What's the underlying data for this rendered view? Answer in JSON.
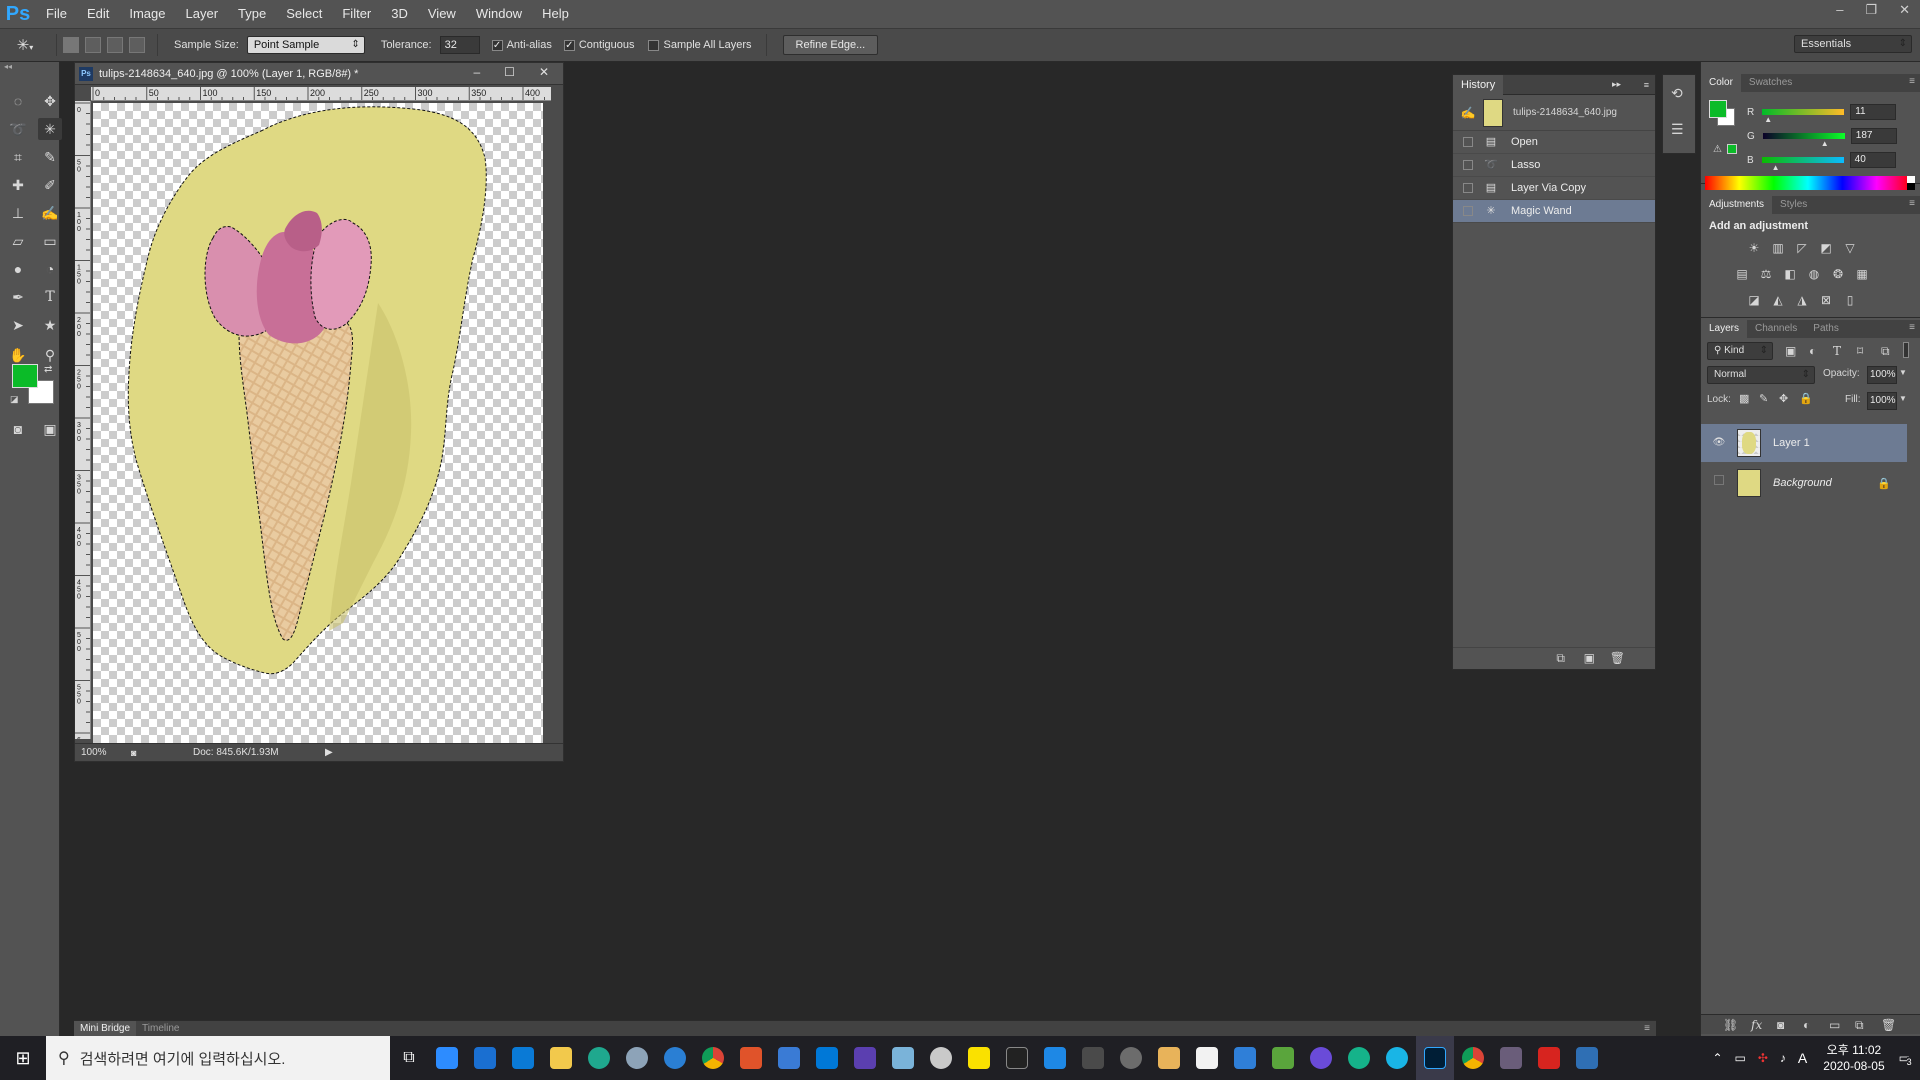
{
  "app": {
    "logo": "Ps",
    "menu": [
      "File",
      "Edit",
      "Image",
      "Layer",
      "Type",
      "Select",
      "Filter",
      "3D",
      "View",
      "Window",
      "Help"
    ],
    "win_minimize": "–",
    "win_restore": "❐",
    "win_close": "✕"
  },
  "options": {
    "sample_size_label": "Sample Size:",
    "sample_size_value": "Point Sample",
    "tolerance_label": "Tolerance:",
    "tolerance_value": "32",
    "anti_alias_label": "Anti-alias",
    "anti_alias_checked": true,
    "contiguous_label": "Contiguous",
    "contiguous_checked": true,
    "sample_all_layers_label": "Sample All Layers",
    "sample_all_layers_checked": false,
    "refine_edge_label": "Refine Edge...",
    "workspace_value": "Essentials"
  },
  "document": {
    "icon": "Ps",
    "title": "tulips-2148634_640.jpg @ 100% (Layer 1, RGB/8#) *",
    "zoom": "100%",
    "doc_size": "Doc: 845.6K/1.93M",
    "ruler_top": [
      "0",
      "50",
      "100",
      "150",
      "200",
      "250",
      "300",
      "350",
      "400"
    ],
    "ruler_left": [
      "0",
      "5\n0",
      "1\n0\n0",
      "1\n5\n0",
      "2\n0\n0",
      "2\n5\n0",
      "3\n0\n0",
      "3\n5\n0",
      "4\n0\n0",
      "4\n5\n0",
      "5\n0\n0",
      "5\n5\n0",
      "6\n0\n0"
    ]
  },
  "history": {
    "tab": "History",
    "snapshot_label": "tulips-2148634_640.jpg",
    "items": [
      {
        "label": "Open",
        "icon": "document-icon"
      },
      {
        "label": "Lasso",
        "icon": "lasso-icon"
      },
      {
        "label": "Layer Via Copy",
        "icon": "document-icon"
      },
      {
        "label": "Magic Wand",
        "icon": "magic-wand-icon"
      }
    ],
    "selected_index": 3
  },
  "color_panel": {
    "tabs": [
      "Color",
      "Swatches"
    ],
    "r_label": "R",
    "r_value": "11",
    "g_label": "G",
    "g_value": "187",
    "b_label": "B",
    "b_value": "40",
    "foreground": "#0bbb28",
    "background": "#ffffff"
  },
  "adjustments": {
    "tabs": [
      "Adjustments",
      "Styles"
    ],
    "heading": "Add an adjustment"
  },
  "layers": {
    "tabs": [
      "Layers",
      "Channels",
      "Paths"
    ],
    "kind_label": "Kind",
    "blend_mode": "Normal",
    "opacity_label": "Opacity:",
    "opacity_value": "100%",
    "lock_label": "Lock:",
    "fill_label": "Fill:",
    "fill_value": "100%",
    "items": [
      {
        "name": "Layer 1",
        "visible": true,
        "selected": true
      },
      {
        "name": "Background",
        "visible": false,
        "selected": false,
        "locked": true
      }
    ]
  },
  "bottom_tabs": [
    "Mini Bridge",
    "Timeline"
  ],
  "taskbar": {
    "search_placeholder": "검색하려면 여기에 입력하십시오.",
    "time": "오후 11:02",
    "date": "2020-08-05",
    "ime": "A",
    "notifications": "3"
  },
  "colors": {
    "accent_selection": "#6d7b93",
    "panel_bg": "#535353",
    "workspace_bg": "#282828",
    "yellow_bg": "#dfd983"
  }
}
